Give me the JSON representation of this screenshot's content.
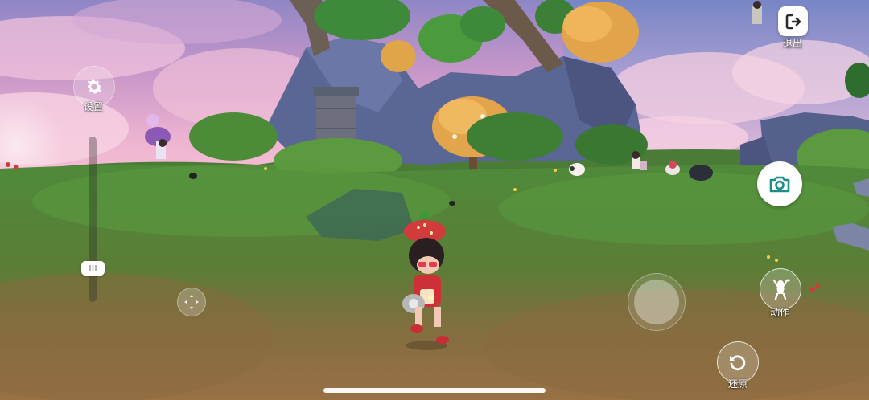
{
  "hud": {
    "settings_label": "设置",
    "exit_label": "退出",
    "actions_label": "动作",
    "restore_label": "还原"
  },
  "icons": {
    "settings": "gear-icon",
    "exit": "exit-door-icon",
    "camera": "camera-icon",
    "actions": "dance-pose-icon",
    "restore": "rotate-ccw-icon"
  },
  "colors": {
    "camera_icon": "#1f8c87",
    "exit_icon": "#2b2b2b",
    "hud_text": "#ffffff"
  }
}
